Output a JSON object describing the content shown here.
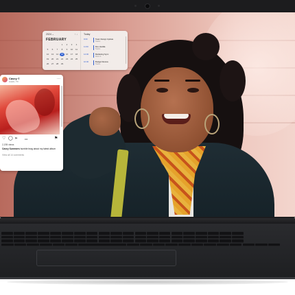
{
  "calendar_widget": {
    "year_label": "2024 ⌄",
    "month": "FEBRUARY",
    "nav_arrows": "↑ ↓",
    "days": [
      "",
      "",
      "",
      "1",
      "2",
      "3",
      "4",
      "5",
      "6",
      "7",
      "8",
      "9",
      "10",
      "11",
      "12",
      "13",
      "14",
      "15",
      "16",
      "17",
      "18",
      "19",
      "20",
      "21",
      "22",
      "23",
      "24",
      "25",
      "26",
      "27",
      "28",
      "29",
      "",
      "",
      "",
      ""
    ],
    "today": "15",
    "panel_head": "Today",
    "events": [
      {
        "time": "9:00",
        "title": "Team Design Update",
        "sub": "Teams"
      },
      {
        "time": "11:30",
        "title": "Dev Huddle",
        "sub": "Teams"
      },
      {
        "time": "14:00",
        "title": "Marketing Sync",
        "sub": "Room 4"
      },
      {
        "time": "16:00",
        "title": "Budget Review",
        "sub": "Teams"
      }
    ]
  },
  "social_widget": {
    "name": "Casey ©",
    "location": "Austin, TX",
    "more": "⋯",
    "views": "2,205 views",
    "caption_user": "Casey Summers",
    "caption_text": "humble brag about my latest album",
    "comments": "View all 14 comments",
    "actions": {
      "like": "♡",
      "comment": "◯",
      "share": "➢",
      "dots": "•••",
      "save": "⚑"
    }
  },
  "taskbar": {
    "icons": [
      "windows-start",
      "search",
      "task-view",
      "widgets",
      "teams-chat",
      "file-explorer",
      "edge",
      "store"
    ],
    "colors": [
      "#2a73d9",
      "#333333",
      "#444444",
      "#3a6fd0",
      "#7b61c9",
      "#e5b43c",
      "#1b9b8a",
      "#3b82e0"
    ]
  },
  "colors": {
    "accent": "#2f5fd0",
    "laptop_body": "#1c1c1e"
  }
}
